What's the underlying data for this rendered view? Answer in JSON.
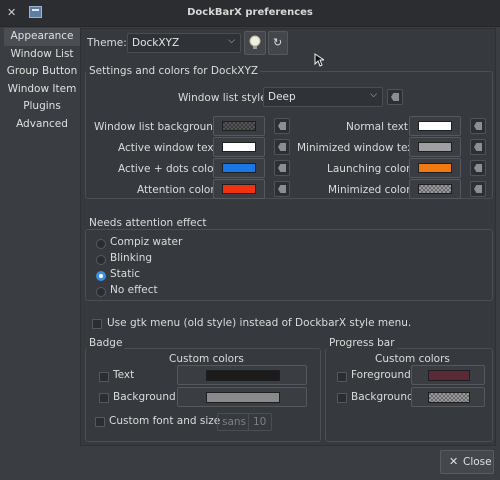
{
  "window": {
    "title": "DockBarX preferences",
    "close_glyph": "✕"
  },
  "sidebar": {
    "items": [
      {
        "label": "Appearance",
        "active": true
      },
      {
        "label": "Window List"
      },
      {
        "label": "Group Button"
      },
      {
        "label": "Window Item"
      },
      {
        "label": "Plugins"
      },
      {
        "label": "Advanced"
      }
    ]
  },
  "theme": {
    "label": "Theme:",
    "value": "DockXYZ",
    "chevron": "⌵",
    "info_icon": "lightbulb-icon",
    "reload_icon": "reload-icon",
    "reload_glyph": "↻"
  },
  "settings": {
    "title": "Settings and colors for DockXYZ",
    "style_label": "Window list style:",
    "style_value": "Deep",
    "colors_left": [
      {
        "label": "Window list background",
        "color": "checker-dark"
      },
      {
        "label": "Active window text",
        "color": "#ffffff"
      },
      {
        "label": "Active + dots color",
        "color": "#1a78e6"
      },
      {
        "label": "Attention color",
        "color": "#f0320f"
      }
    ],
    "colors_right": [
      {
        "label": "Normal text",
        "color": "#ffffff"
      },
      {
        "label": "Minimized window text",
        "color": "#a0a0a0"
      },
      {
        "label": "Launching color",
        "color": "#f07a12"
      },
      {
        "label": "Minimized color",
        "color": "checker-light"
      }
    ]
  },
  "attention": {
    "title": "Needs attention effect",
    "options": [
      "Compiz water",
      "Blinking",
      "Static",
      "No effect"
    ],
    "selected": "Static"
  },
  "gtk_menu": {
    "label": "Use gtk menu (old style) instead of DockbarX style menu.",
    "checked": false
  },
  "badge": {
    "title": "Badge",
    "custom_colors": "Custom colors",
    "text_label": "Text",
    "text_color": "#1b1b1b",
    "background_label": "Background",
    "background_color": "#8a8a8a",
    "font_label": "Custom font and size",
    "font_name": "sans",
    "font_size": "10"
  },
  "progress": {
    "title": "Progress bar",
    "custom_colors": "Custom colors",
    "foreground_label": "Foreground",
    "foreground_color": "#5a2a36",
    "background_label": "Background",
    "background_color": "checker-light"
  },
  "footer": {
    "close_label": "Close",
    "close_icon": "close-icon",
    "close_glyph": "✕"
  },
  "colors": {
    "accent": "#3a8fe0",
    "window_bg": "#3a3d41"
  }
}
